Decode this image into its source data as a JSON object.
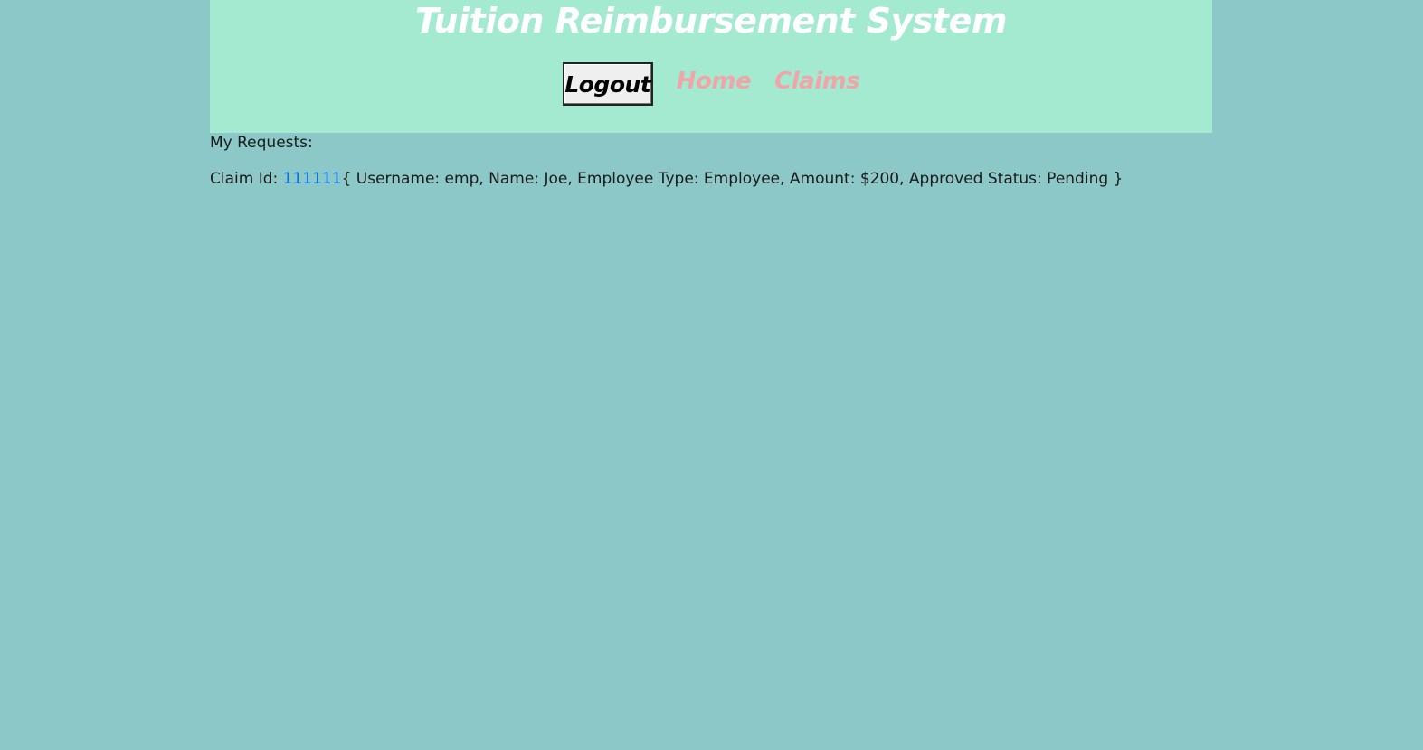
{
  "header": {
    "title": "Tuition Reimbursement System",
    "logout_label": "Logout",
    "nav": [
      {
        "label": "Home"
      },
      {
        "label": "Claims"
      }
    ]
  },
  "main": {
    "heading": "My Requests:",
    "claims": [
      {
        "prefix": "Claim Id: ",
        "id": "111111",
        "details": "{ Username: emp, Name: Joe, Employee Type: Employee, Amount: $200, Approved Status: Pending }"
      }
    ]
  },
  "colors": {
    "background": "#8cc8c8",
    "header_background": "#a3ead0",
    "title": "#ffffff",
    "nav_link": "#f0a6a8",
    "claim_link": "#0a6fe0"
  }
}
